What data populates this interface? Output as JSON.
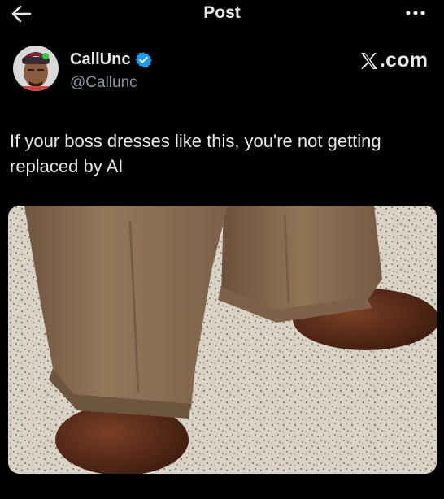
{
  "topbar": {
    "title": "Post",
    "back_icon": "arrow-left-icon",
    "more_icon": "more-horizontal-icon"
  },
  "author": {
    "name": "CallUnc",
    "handle": "@Callunc",
    "verified": true,
    "verified_color": "#1d9bf0"
  },
  "brand": {
    "text": ".com",
    "logo_icon": "x-logo-icon"
  },
  "post": {
    "text": "If your boss dresses like this, you're not getting replaced by AI"
  },
  "media": {
    "alt_icon": "photo",
    "colors": {
      "pants": "#8f7152",
      "shoes": "#5a2d1b",
      "floor": "#d9d4cb"
    }
  },
  "colors": {
    "background": "#000000",
    "text": "#e7e9ea",
    "muted": "#8b98a5",
    "accent": "#1d9bf0"
  }
}
